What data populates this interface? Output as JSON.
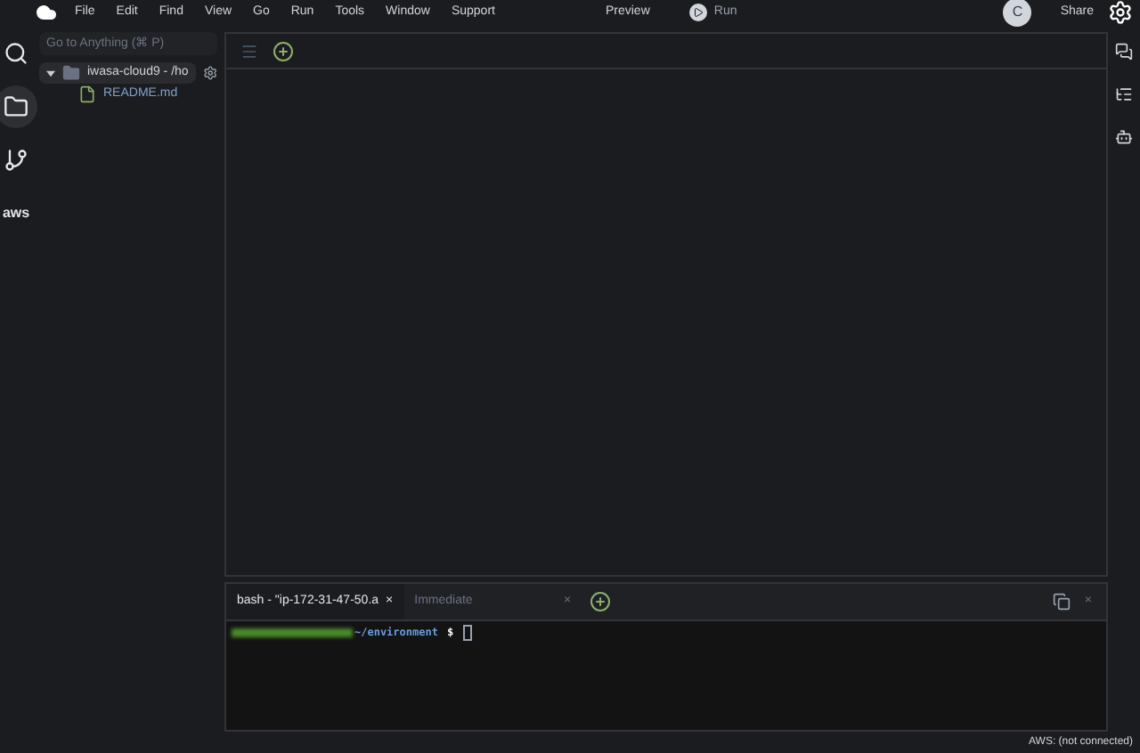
{
  "menu_bar": {
    "items": [
      "File",
      "Edit",
      "Find",
      "View",
      "Go",
      "Run",
      "Tools",
      "Window",
      "Support"
    ],
    "preview": "Preview",
    "run": "Run",
    "avatar": "C",
    "share": "Share"
  },
  "left_rail": [
    {
      "kind": "search",
      "selected": false
    },
    {
      "kind": "folder",
      "selected": true
    },
    {
      "kind": "git",
      "selected": false
    },
    {
      "kind": "aws",
      "label": "aws",
      "selected": false
    }
  ],
  "file_panel": {
    "search": {
      "placeholder": "Go to Anything (⌘ P)"
    },
    "tree": [
      {
        "name": "iwasa-cloud9 - /ho",
        "expanded": true,
        "children": [
          {
            "name": "README.md"
          }
        ]
      }
    ]
  },
  "terminal": {
    "tabs": [
      {
        "label": "bash - \"ip-172-31-47-50.a",
        "selected": true,
        "close": "×"
      },
      {
        "label": "Immediate",
        "selected": false,
        "close": "×"
      }
    ],
    "close": "×",
    "prompt": "~/environment",
    "prompt_sign": "$"
  },
  "status_bar": "AWS: (not connected)"
}
